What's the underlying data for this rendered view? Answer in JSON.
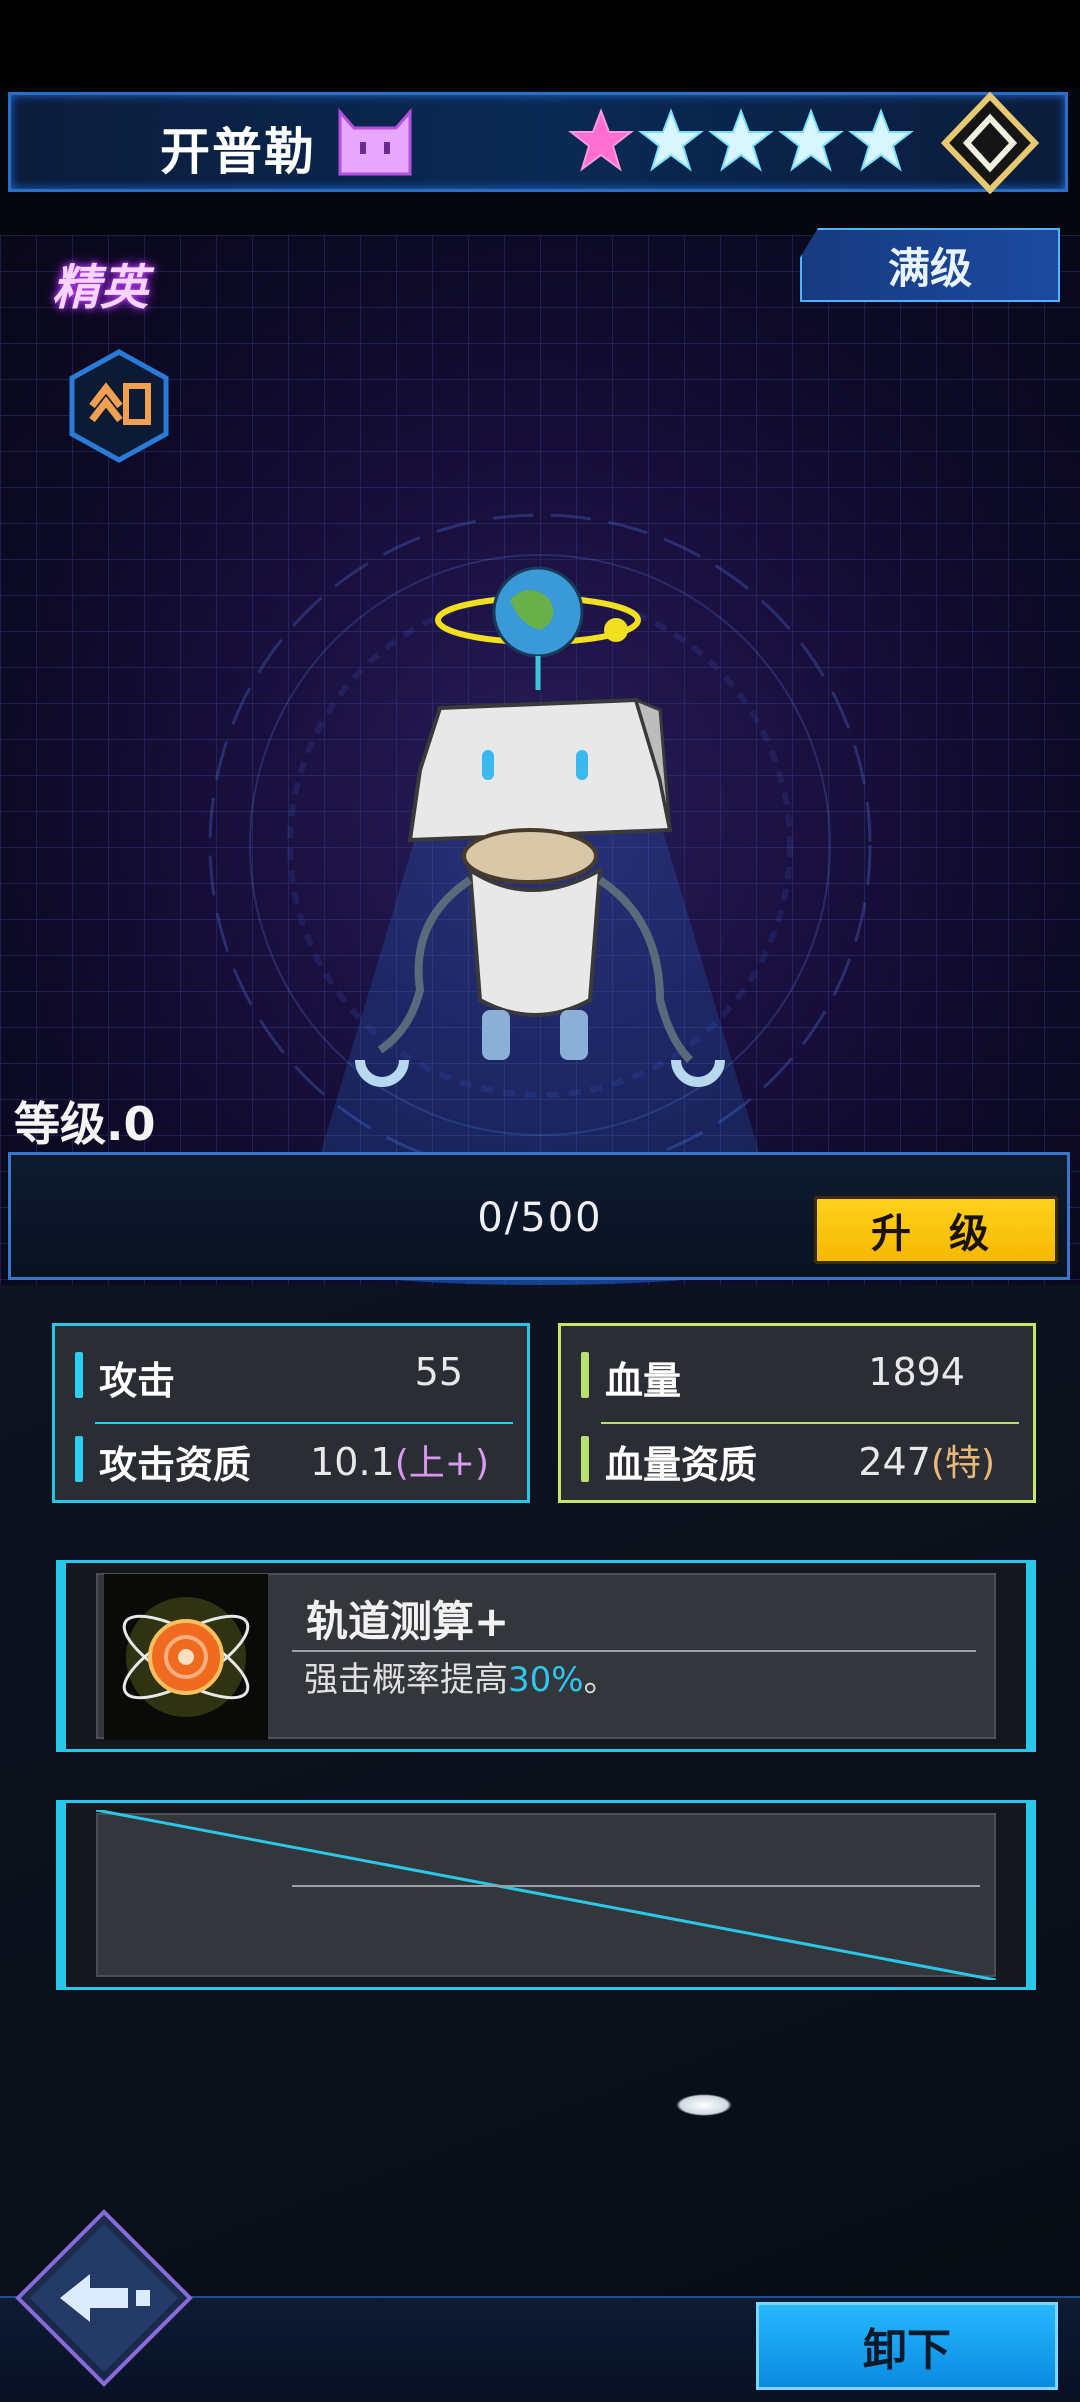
{
  "header": {
    "hero_name": "开普勒",
    "stars_filled": 1,
    "stars_total": 5,
    "colors": {
      "star_filled": "#ff6fd0",
      "star_empty": "#d8f6ff"
    }
  },
  "hero": {
    "rarity_label": "精英",
    "max_level_label": "满级"
  },
  "level": {
    "label": "等级.0",
    "exp_text": "0/500",
    "exp_fraction": 0,
    "upgrade_label": "升 级"
  },
  "stats": {
    "attack": {
      "name": "攻击",
      "value": "55"
    },
    "attack_aptitude": {
      "name": "攻击资质",
      "value": "10.1",
      "grade": "(上+)"
    },
    "hp": {
      "name": "血量",
      "value": "1894"
    },
    "hp_aptitude": {
      "name": "血量资质",
      "value": "247",
      "grade": "(特)"
    }
  },
  "skill": {
    "name": "轨道测算+",
    "desc_before": "强击概率提高",
    "desc_highlight": "30%",
    "desc_after": "。"
  },
  "footer": {
    "unequip_label": "卸下"
  },
  "icons": [
    "cat-icon",
    "star-icon",
    "rank-diamond-icon",
    "class-chevron-icon",
    "orbit-skill-icon",
    "back-arrow-icon"
  ]
}
